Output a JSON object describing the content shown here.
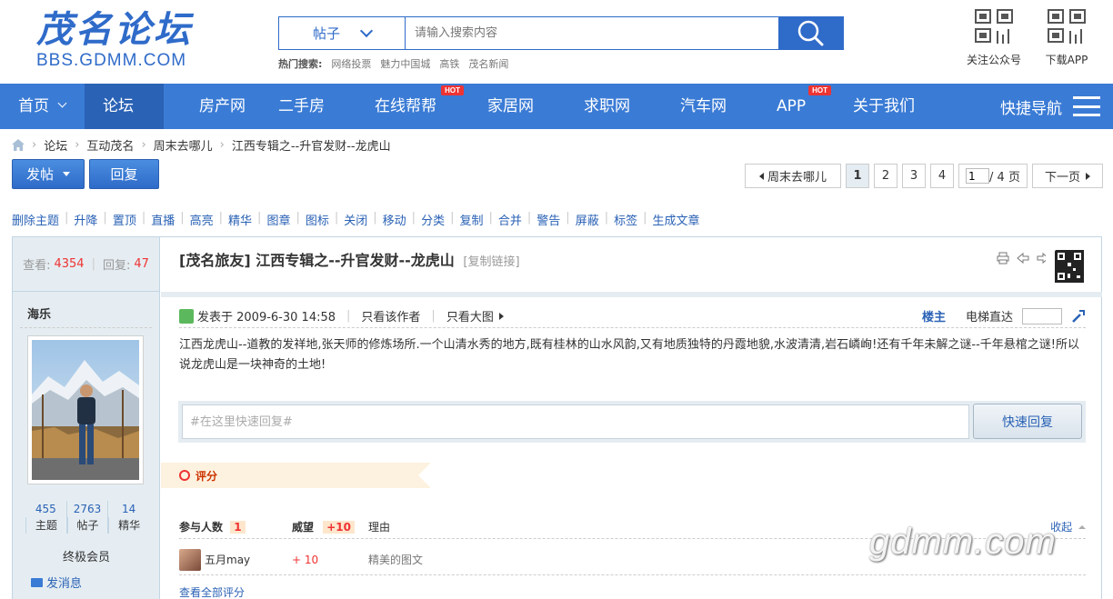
{
  "header": {
    "logo_cn": "茂名论坛",
    "logo_en": "BBS.GDMM.COM",
    "search": {
      "type": "帖子",
      "placeholder": "请输入搜索内容"
    },
    "hot_label": "热门搜索:",
    "hot_terms": [
      "网络投票",
      "魅力中国城",
      "高铁",
      "茂名新闻"
    ],
    "follow_label": "关注公众号",
    "download_label": "下载APP"
  },
  "nav": {
    "items": [
      {
        "label": "首页"
      },
      {
        "label": "论坛"
      },
      {
        "label": "房产网"
      },
      {
        "label": "二手房"
      },
      {
        "label": "在线帮帮"
      },
      {
        "label": "家居网"
      },
      {
        "label": "求职网"
      },
      {
        "label": "汽车网"
      },
      {
        "label": "APP"
      },
      {
        "label": "关于我们"
      }
    ],
    "hot_badge": "HOT",
    "quick_nav": "快捷导航"
  },
  "breadcrumb": [
    "论坛",
    "互动茂名",
    "周末去哪儿",
    "江西专辑之--升官发财--龙虎山"
  ],
  "actions": {
    "post_label": "发帖",
    "reply_label": "回复"
  },
  "pager": {
    "back_label": "周末去哪儿",
    "pages": [
      "1",
      "2",
      "3",
      "4"
    ],
    "current": "1",
    "input_value": "1",
    "total": " / 4 页",
    "next_label": "下一页"
  },
  "modbar": [
    "删除主题",
    "升降",
    "置顶",
    "直播",
    "高亮",
    "精华",
    "图章",
    "图标",
    "关闭",
    "移动",
    "分类",
    "复制",
    "合并",
    "警告",
    "屏蔽",
    "标签",
    "生成文章"
  ],
  "thread": {
    "views_label": "查看:",
    "views": "4354",
    "replies_label": "回复:",
    "replies": "47",
    "category": "[茂名旅友]",
    "title": "江西专辑之--升官发财--龙虎山",
    "copy_link": "[复制链接]"
  },
  "author": {
    "name": "海乐",
    "topics": "455",
    "topics_label": "主题",
    "posts": "2763",
    "posts_label": "帖子",
    "digest": "14",
    "digest_label": "精华",
    "rank": "终极会员",
    "send_msg": "发消息"
  },
  "post": {
    "posted_at": "发表于 2009-6-30 14:58",
    "only_author": "只看该作者",
    "only_images": "只看大图",
    "floor": "楼主",
    "jump_label": "电梯直达",
    "body": "江西龙虎山--道教的发祥地,张天师的修炼场所.一个山清水秀的地方,既有桂林的山水风韵,又有地质独特的丹霞地貌,水波清清,岩石嶙峋!还有千年未解之谜--千年悬棺之谜!所以说龙虎山是一块神奇的土地!"
  },
  "quick_reply": {
    "placeholder": "#在这里快速回复#",
    "button": "快速回复"
  },
  "rating": {
    "label": "评分",
    "head_participants": "参与人数",
    "participants": "1",
    "head_prestige": "威望",
    "prestige": "+10",
    "head_reason": "理由",
    "collapse": "收起",
    "rows": [
      {
        "user": "五月may",
        "points": "+ 10",
        "reason": "精美的图文"
      }
    ],
    "view_all": "查看全部评分"
  },
  "watermark": "gdmm.com",
  "colors": {
    "brand": "#2f6bc9",
    "nav_bg": "#3a7bd5",
    "highlight": "#e33333"
  }
}
